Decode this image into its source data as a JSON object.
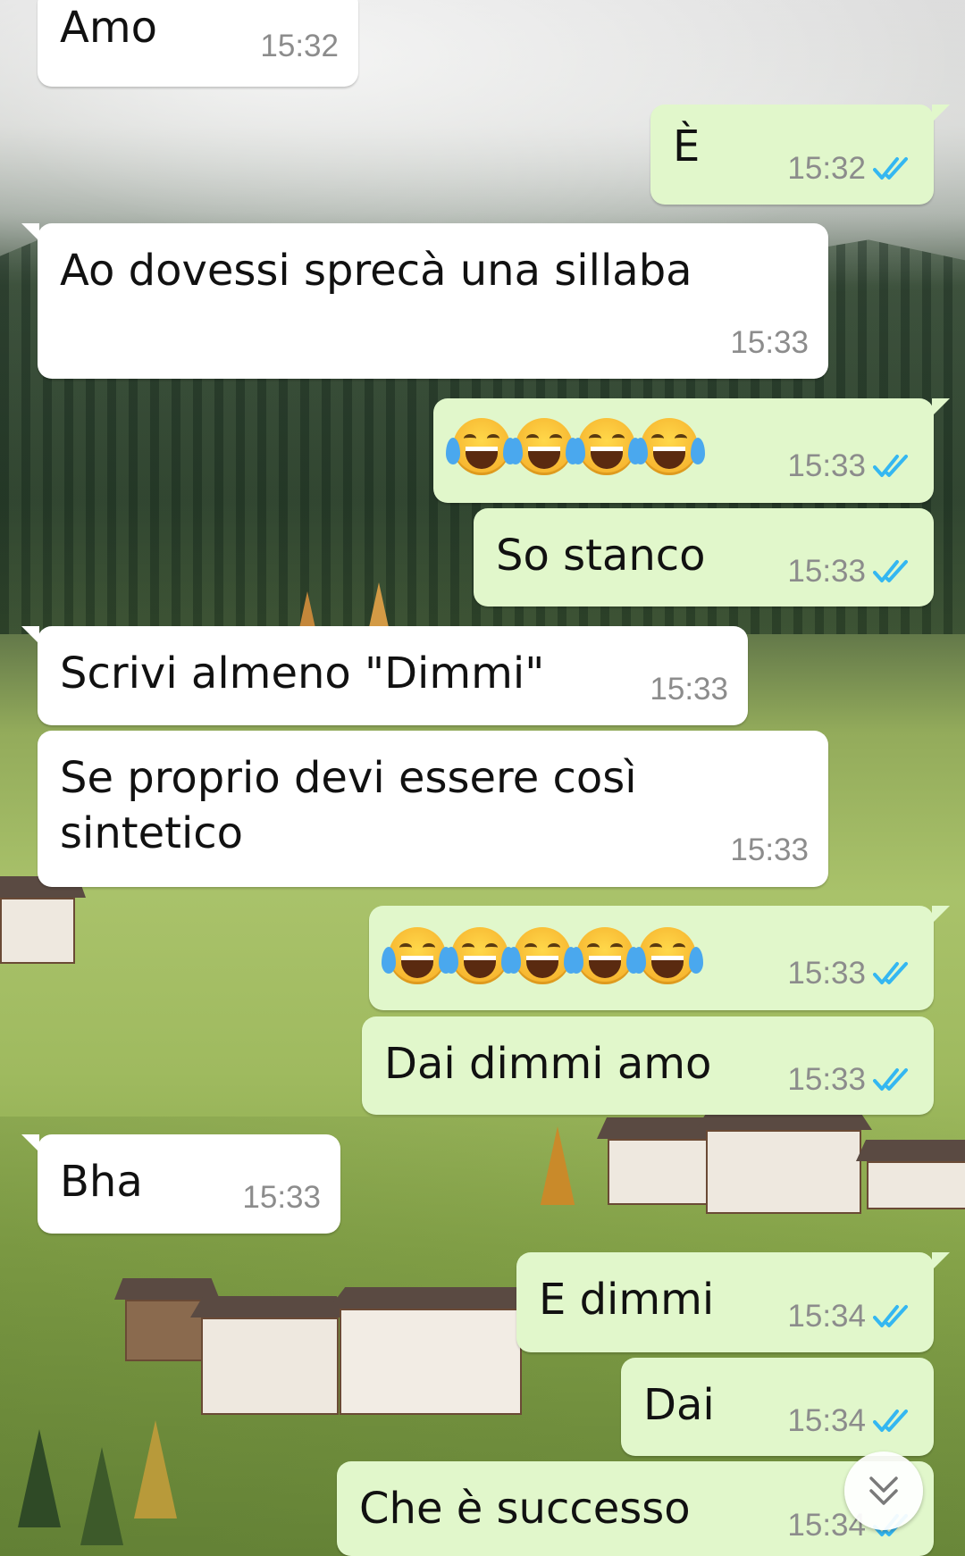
{
  "colors": {
    "incoming_bubble": "#ffffff",
    "outgoing_bubble": "#e1f7cb",
    "time_text": "#8c8c8c",
    "read_ticks": "#34b7f1"
  },
  "icons": {
    "read_receipt": "double-check-icon",
    "scroll_down": "double-chevron-down-icon",
    "emoji": "face-with-tears-of-joy"
  },
  "messages": [
    {
      "direction": "in",
      "text": "Amo",
      "time": "15:32"
    },
    {
      "direction": "out",
      "text": "È",
      "time": "15:32",
      "read": true
    },
    {
      "direction": "in",
      "text": "Ao dovessi sprecà una sillaba",
      "time": "15:33"
    },
    {
      "direction": "out",
      "text": "😂😂😂😂",
      "time": "15:33",
      "read": true
    },
    {
      "direction": "out",
      "text": "So stanco",
      "time": "15:33",
      "read": true
    },
    {
      "direction": "in",
      "text": "Scrivi almeno \"Dimmi\"",
      "time": "15:33"
    },
    {
      "direction": "in",
      "text": "Se proprio devi essere così sintetico",
      "time": "15:33"
    },
    {
      "direction": "out",
      "text": "😂😂😂😂😂",
      "time": "15:33",
      "read": true
    },
    {
      "direction": "out",
      "text": "Dai dimmi amo",
      "time": "15:33",
      "read": true
    },
    {
      "direction": "in",
      "text": "Bha",
      "time": "15:33"
    },
    {
      "direction": "out",
      "text": "E dimmi",
      "time": "15:34",
      "read": true
    },
    {
      "direction": "out",
      "text": "Dai",
      "time": "15:34",
      "read": true
    },
    {
      "direction": "out",
      "text": "Che è successo",
      "time": "15:34",
      "read": true
    }
  ]
}
